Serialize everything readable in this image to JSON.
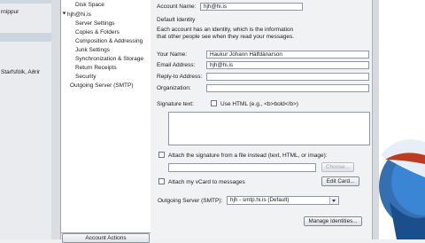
{
  "left_panel": {
    "items": [
      "rnippur",
      "Starfsfólk, Aðrir"
    ]
  },
  "tree": {
    "items": [
      {
        "label": "Disk Space"
      },
      {
        "label": "hjh@hi.is"
      },
      {
        "label": "Server Settings"
      },
      {
        "label": "Copies & Folders"
      },
      {
        "label": "Composition & Addressing"
      },
      {
        "label": "Junk Settings"
      },
      {
        "label": "Synchronization & Storage"
      },
      {
        "label": "Return Receipts"
      },
      {
        "label": "Security"
      },
      {
        "label": "Outgoing Server (SMTP)"
      }
    ],
    "account_actions_label": "Account Actions"
  },
  "form": {
    "account_name_label": "Account Name:",
    "account_name_value": "hjh@hi.is",
    "default_identity_heading": "Default Identity",
    "identity_description": "Each account has an identity, which is the information that other people see when they read your messages.",
    "your_name_label": "Your Name:",
    "your_name_value": "Haukur Jóhann Hálfdánarson",
    "email_label": "Email Address:",
    "email_value": "hjh@hi.is",
    "reply_to_label": "Reply-to Address:",
    "organization_label": "Organization:",
    "signature_label": "Signature text:",
    "use_html_label": "Use HTML (e.g., <b>bold</b>)",
    "attach_sig_label": "Attach the signature from a file instead (text, HTML, or image):",
    "choose_button": "Choose...",
    "attach_vcard_label": "Attach my vCard to messages",
    "edit_card_button": "Edit Card...",
    "outgoing_server_label": "Outgoing Server (SMTP):",
    "outgoing_server_value": "hjh - smtp.hi.is (Default)",
    "manage_identities_button": "Manage Identities..."
  }
}
